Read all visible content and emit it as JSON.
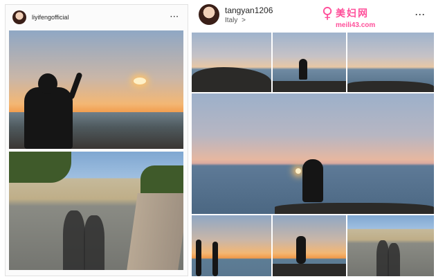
{
  "left_post": {
    "username": "liyifengofficial",
    "more_icon": "ellipsis-icon"
  },
  "right_post": {
    "username": "tangyan1206",
    "location": "Italy",
    "location_chevron": ">",
    "more_icon": "ellipsis-icon"
  },
  "watermark": {
    "brand": "美妇网",
    "domain": "meili43.com"
  },
  "colors": {
    "watermark": "#ff4f9a",
    "text": "#262626"
  }
}
